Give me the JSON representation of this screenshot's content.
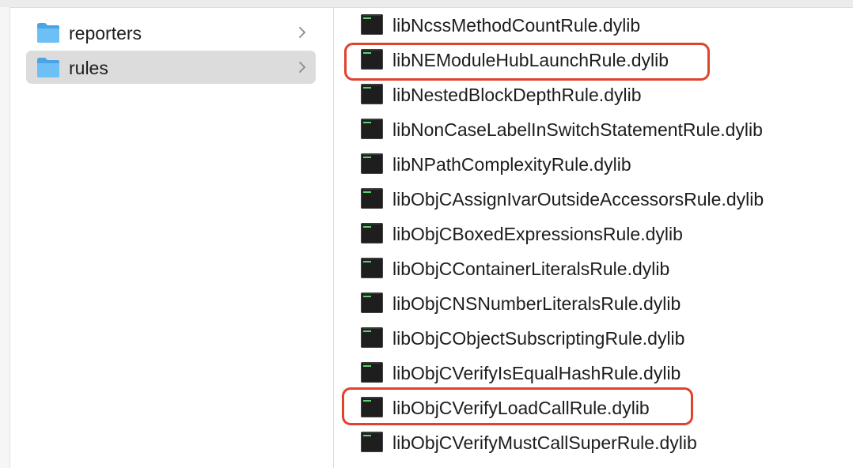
{
  "folders": [
    {
      "name": "reporters",
      "selected": false
    },
    {
      "name": "rules",
      "selected": true
    }
  ],
  "files": [
    {
      "name": "libNcssMethodCountRule.dylib"
    },
    {
      "name": "libNEModuleHubLaunchRule.dylib",
      "highlighted": true
    },
    {
      "name": "libNestedBlockDepthRule.dylib"
    },
    {
      "name": "libNonCaseLabelInSwitchStatementRule.dylib"
    },
    {
      "name": "libNPathComplexityRule.dylib"
    },
    {
      "name": "libObjCAssignIvarOutsideAccessorsRule.dylib"
    },
    {
      "name": "libObjCBoxedExpressionsRule.dylib"
    },
    {
      "name": "libObjCContainerLiteralsRule.dylib"
    },
    {
      "name": "libObjCNSNumberLiteralsRule.dylib"
    },
    {
      "name": "libObjCObjectSubscriptingRule.dylib"
    },
    {
      "name": "libObjCVerifyIsEqualHashRule.dylib"
    },
    {
      "name": "libObjCVerifyLoadCallRule.dylib",
      "highlighted": true
    },
    {
      "name": "libObjCVerifyMustCallSuperRule.dylib"
    }
  ],
  "colors": {
    "highlight": "#e0432d",
    "selection": "#dcdcdc",
    "folder_blue": "#5eb5ef"
  },
  "icons": {
    "folder": "folder-icon",
    "chevron": "chevron-right-icon",
    "file": "executable-file-icon"
  }
}
